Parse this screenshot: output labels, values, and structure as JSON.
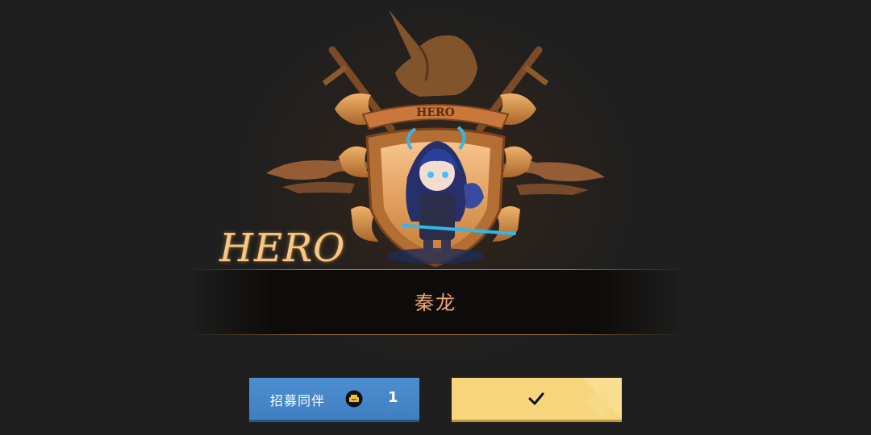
{
  "banner": {
    "crest_text": "HERO",
    "script_title": "HERO"
  },
  "hero": {
    "name": "秦龙"
  },
  "buttons": {
    "recruit_label": "招募同伴",
    "recruit_cost": "1",
    "confirm_icon": "checkmark-icon",
    "cost_icon": "recruit-token-icon"
  },
  "colors": {
    "recruit_button": "#4588c9",
    "confirm_button": "#f6d57c",
    "name_text": "#f0a772",
    "script_title": "#f2c98a"
  }
}
